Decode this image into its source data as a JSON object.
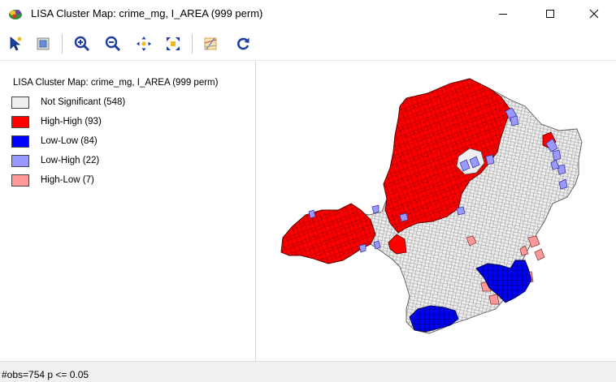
{
  "window": {
    "title": "LISA Cluster Map: crime_mg, I_AREA (999 perm)",
    "icon": "geoda-app-icon",
    "controls": [
      "minimize-icon",
      "maximize-icon",
      "close-icon"
    ]
  },
  "toolbar": {
    "buttons": [
      "select-arrow-icon",
      "selectable-fill-icon",
      "zoom-in-icon",
      "zoom-out-icon",
      "pan-icon",
      "fit-to-window-icon",
      "basemap-icon",
      "refresh-icon"
    ]
  },
  "legend": {
    "title": "LISA Cluster Map: crime_mg, I_AREA (999 perm)",
    "items": [
      {
        "label": "Not Significant (548)",
        "color": "#eeeeee"
      },
      {
        "label": "High-High (93)",
        "color": "#ff0000"
      },
      {
        "label": "Low-Low (84)",
        "color": "#0000ff"
      },
      {
        "label": "Low-High (22)",
        "color": "#9999ff"
      },
      {
        "label": "High-Low (7)",
        "color": "#ff9999"
      }
    ]
  },
  "status": {
    "text": "#obs=754  p <= 0.05"
  },
  "colors": {
    "not_significant": "#eeeeee",
    "high_high": "#ff0000",
    "low_low": "#0000ff",
    "low_high": "#9999ff",
    "high_low": "#ff9999",
    "border": "#555555"
  }
}
